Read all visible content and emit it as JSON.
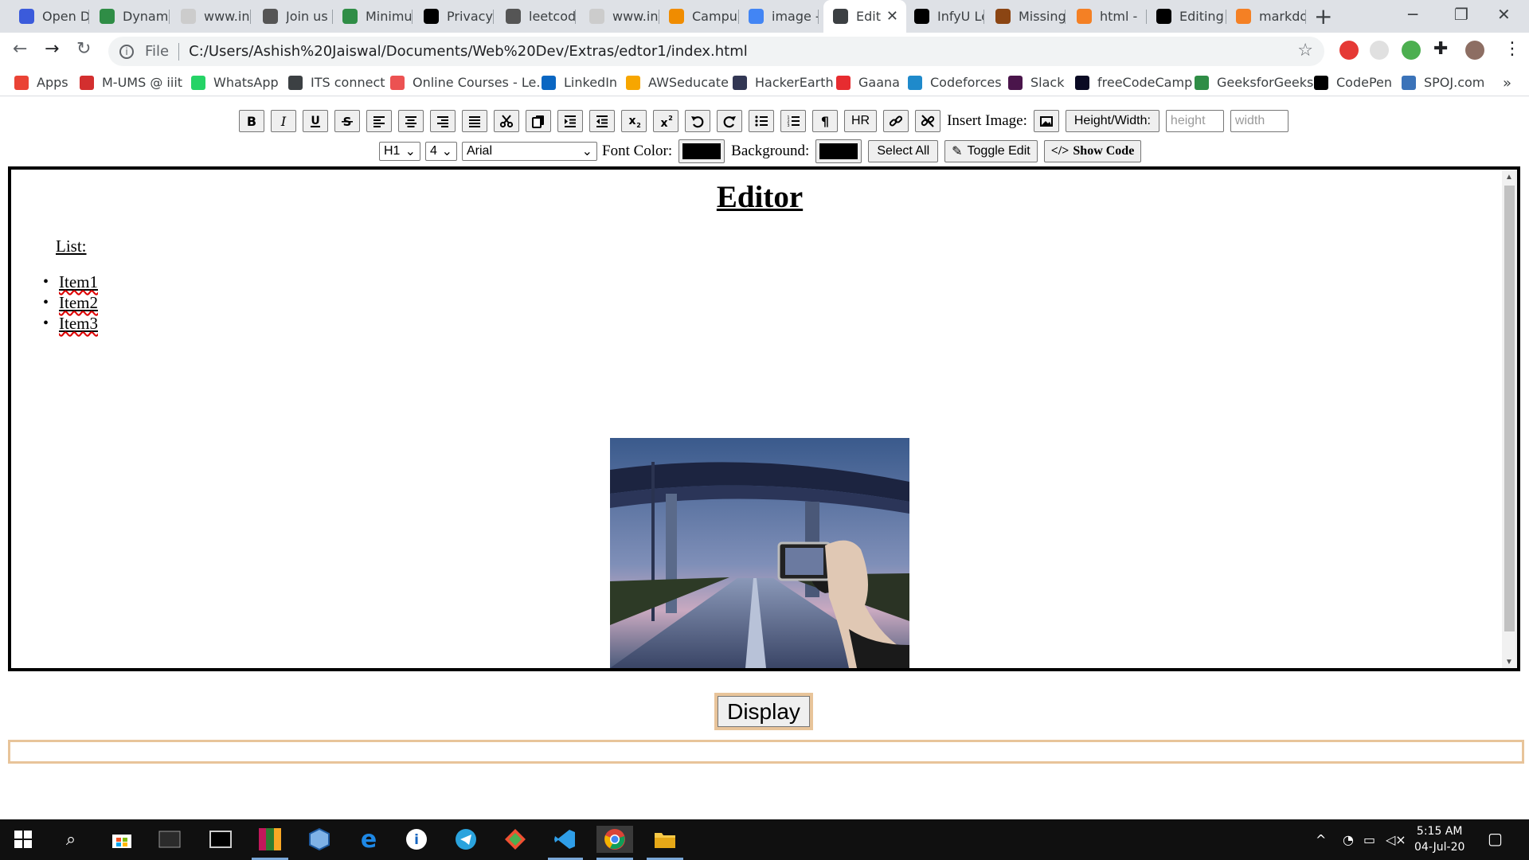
{
  "browser": {
    "tabs": [
      {
        "title": "Open D",
        "icon": "shield-icon",
        "color": "#3b5bdb"
      },
      {
        "title": "Dynami",
        "icon": "geeks-icon",
        "color": "#2f8d46"
      },
      {
        "title": "www.int",
        "icon": "page-icon",
        "color": "#cccccc"
      },
      {
        "title": "Join us",
        "icon": "power-icon",
        "color": "#555555"
      },
      {
        "title": "Minimu",
        "icon": "geeks-icon",
        "color": "#2f8d46"
      },
      {
        "title": "Privacy",
        "icon": "a-icon",
        "color": "#000000"
      },
      {
        "title": "leetcod",
        "icon": "leetcode-icon",
        "color": "#555555"
      },
      {
        "title": "www.int",
        "icon": "page-icon",
        "color": "#cccccc"
      },
      {
        "title": "Campu",
        "icon": "campus-icon",
        "color": "#f08c00"
      },
      {
        "title": "image -",
        "icon": "google-icon",
        "color": "#4285f4"
      },
      {
        "title": "Edit",
        "icon": "globe-icon",
        "color": "#3c4043"
      },
      {
        "title": "InfyU Le",
        "icon": "infy-icon",
        "color": "#000000"
      },
      {
        "title": "Missing",
        "icon": "cc-icon",
        "color": "#8b4513"
      },
      {
        "title": "html - ",
        "icon": "stack-icon",
        "color": "#f48024"
      },
      {
        "title": "Editing",
        "icon": "github-icon",
        "color": "#000000"
      },
      {
        "title": "markdo",
        "icon": "stack-icon",
        "color": "#f48024"
      }
    ],
    "active_tab_index": 10,
    "address": {
      "scheme": "File",
      "url": "C:/Users/Ashish%20Jaiswal/Documents/Web%20Dev/Extras/edtor1/index.html"
    },
    "bookmarks": [
      {
        "label": "Apps",
        "icon": "apps-grid-icon",
        "color": "#ea4335"
      },
      {
        "label": "M-UMS @ iiit",
        "icon": "mums-icon",
        "color": "#d32f2f"
      },
      {
        "label": "WhatsApp",
        "icon": "whatsapp-icon",
        "color": "#25d366"
      },
      {
        "label": "ITS connect",
        "icon": "globe-icon",
        "color": "#3c4043"
      },
      {
        "label": "Online Courses - Le...",
        "icon": "udemy-icon",
        "color": "#ec5252"
      },
      {
        "label": "LinkedIn",
        "icon": "linkedin-icon",
        "color": "#0a66c2"
      },
      {
        "label": "AWSeducate",
        "icon": "aws-icon",
        "color": "#f7a600"
      },
      {
        "label": "HackerEarth",
        "icon": "hackerearth-icon",
        "color": "#323754"
      },
      {
        "label": "Gaana",
        "icon": "gaana-icon",
        "color": "#e72c30"
      },
      {
        "label": "Codeforces",
        "icon": "codeforces-icon",
        "color": "#1f8acb"
      },
      {
        "label": "Slack",
        "icon": "slack-icon",
        "color": "#4a154b"
      },
      {
        "label": "freeCodeCamp",
        "icon": "fcc-icon",
        "color": "#0a0a23"
      },
      {
        "label": "GeeksforGeeks",
        "icon": "geeks-icon",
        "color": "#2f8d46"
      },
      {
        "label": "CodePen",
        "icon": "codepen-icon",
        "color": "#000000"
      },
      {
        "label": "SPOJ.com",
        "icon": "spoj-icon",
        "color": "#3b73b9"
      }
    ]
  },
  "toolbar": {
    "row1_buttons": [
      {
        "name": "bold-button",
        "label": "B",
        "icon": "bold-icon"
      },
      {
        "name": "italic-button",
        "label": "I",
        "icon": "italic-icon"
      },
      {
        "name": "underline-button",
        "label": "U",
        "icon": "underline-icon"
      },
      {
        "name": "strikethrough-button",
        "label": "S",
        "icon": "strikethrough-icon"
      },
      {
        "name": "align-left-button",
        "label": "",
        "icon": "align-left-icon"
      },
      {
        "name": "align-center-button",
        "label": "",
        "icon": "align-center-icon"
      },
      {
        "name": "align-right-button",
        "label": "",
        "icon": "align-right-icon"
      },
      {
        "name": "justify-button",
        "label": "",
        "icon": "justify-icon"
      },
      {
        "name": "cut-button",
        "label": "",
        "icon": "scissors-icon"
      },
      {
        "name": "copy-button",
        "label": "",
        "icon": "copy-icon"
      },
      {
        "name": "indent-button",
        "label": "",
        "icon": "indent-icon"
      },
      {
        "name": "outdent-button",
        "label": "",
        "icon": "outdent-icon"
      },
      {
        "name": "subscript-button",
        "label": "",
        "icon": "subscript-icon"
      },
      {
        "name": "superscript-button",
        "label": "",
        "icon": "superscript-icon"
      },
      {
        "name": "undo-button",
        "label": "",
        "icon": "undo-icon"
      },
      {
        "name": "redo-button",
        "label": "",
        "icon": "redo-icon"
      },
      {
        "name": "unordered-list-button",
        "label": "",
        "icon": "bullet-list-icon"
      },
      {
        "name": "ordered-list-button",
        "label": "",
        "icon": "numbered-list-icon"
      },
      {
        "name": "paragraph-button",
        "label": "¶",
        "icon": "pilcrow-icon"
      },
      {
        "name": "hr-button",
        "label": "HR",
        "icon": ""
      },
      {
        "name": "link-button",
        "label": "",
        "icon": "link-icon"
      },
      {
        "name": "unlink-button",
        "label": "",
        "icon": "unlink-icon"
      }
    ],
    "insert_image_label": "Insert Image:",
    "height_width_label": "Height/Width:",
    "height_placeholder": "height",
    "width_placeholder": "width",
    "heading_select": "H1",
    "size_select": "4",
    "font_select": "Arial",
    "font_color_label": "Font Color:",
    "font_color": "#000000",
    "background_label": "Background:",
    "background_color": "#000000",
    "select_all_label": "Select All",
    "toggle_edit_label": "Toggle Edit",
    "show_code_label": "Show Code"
  },
  "editor": {
    "heading": "Editor",
    "list_label": "List:",
    "list_items": [
      "Item1",
      "Item2",
      "Item3"
    ]
  },
  "display_button_label": "Display",
  "taskbar": {
    "time": "5:15 AM",
    "date": "04-Jul-20",
    "apps": [
      "windows-start-icon",
      "search-icon",
      "store-icon",
      "mysql-icon",
      "terminal-icon",
      "winrar-icon",
      "virtualbox-icon",
      "edge-icon",
      "info-icon",
      "telegram-icon",
      "git-icon",
      "vscode-icon",
      "chrome-icon",
      "file-explorer-icon"
    ]
  }
}
